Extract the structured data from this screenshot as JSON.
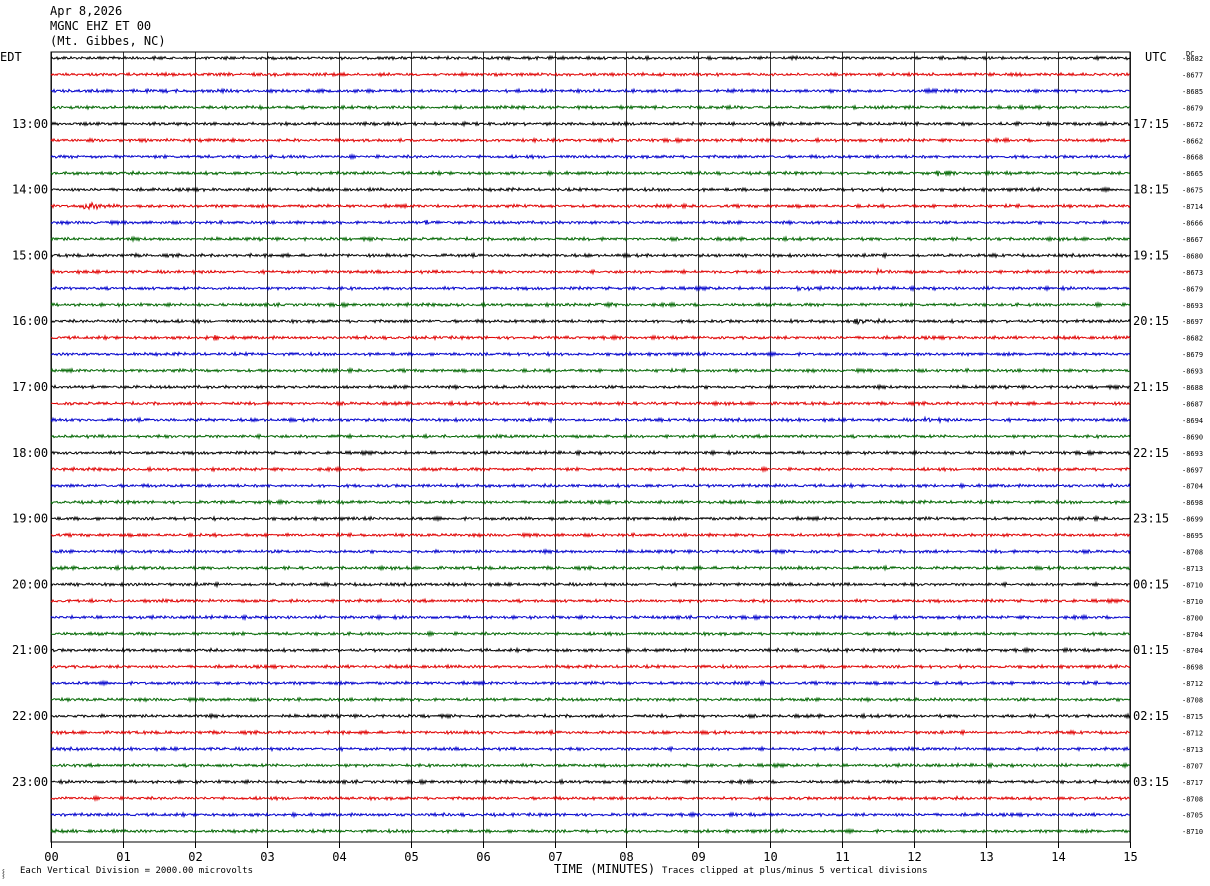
{
  "header": {
    "date": "Apr 8,2026",
    "station": "MGNC EHZ ET 00",
    "location": "(Mt. Gibbes, NC)"
  },
  "footer": {
    "scale_note": "Each Vertical Division = 2000.00 microvolts",
    "clip_note": "Traces clipped at plus/minus 5 vertical divisions",
    "corner_mark": "⸾"
  },
  "chart_data": {
    "type": "line",
    "title": "",
    "xlabel": "TIME (MINUTES)",
    "ylabel_left": "EDT",
    "ylabel_right": "UTC",
    "dc_label": "DC",
    "xlim": [
      0,
      15
    ],
    "x_ticks": [
      "00",
      "01",
      "02",
      "03",
      "04",
      "05",
      "06",
      "07",
      "08",
      "09",
      "10",
      "11",
      "12",
      "13",
      "14",
      "15"
    ],
    "trace_colors": [
      "#000000",
      "#e00000",
      "#0000cc",
      "#006600"
    ],
    "left_hour_labels": [
      "13:00",
      "14:00",
      "15:00",
      "16:00",
      "17:00",
      "18:00",
      "19:00",
      "20:00",
      "21:00",
      "22:00",
      "23:00"
    ],
    "right_hour_labels": [
      "17:15",
      "18:15",
      "19:15",
      "20:15",
      "21:15",
      "22:15",
      "23:15",
      "00:15",
      "01:15",
      "02:15",
      "03:15"
    ],
    "dc_offsets": [
      -8682,
      -8677,
      -8685,
      -8679,
      -8672,
      -8662,
      -8668,
      -8665,
      -8675,
      -8714,
      -8666,
      -8667,
      -8680,
      -8673,
      -8679,
      -8693,
      -8697,
      -8682,
      -8679,
      -8693,
      -8688,
      -8687,
      -8694,
      -8690,
      -8693,
      -8697,
      -8704,
      -8698,
      -8699,
      -8695,
      -8708,
      -8713,
      -8710,
      -8710,
      -8700,
      -8704,
      -8704,
      -8698,
      -8712,
      -8708,
      -8715,
      -8712,
      -8713,
      -8707,
      -8717,
      -8708,
      -8705,
      -8710
    ],
    "events": [
      {
        "trace": 0,
        "minute": 5.85,
        "amplitude": 1.6
      },
      {
        "trace": 7,
        "minute": 12.35,
        "amplitude": 1.5
      },
      {
        "trace": 9,
        "minute": 0.5,
        "amplitude": 5.0
      },
      {
        "trace": 10,
        "minute": 5.2,
        "amplitude": 1.6
      },
      {
        "trace": 13,
        "minute": 11.5,
        "amplitude": 1.6
      },
      {
        "trace": 14,
        "minute": 10.4,
        "amplitude": 1.6
      },
      {
        "trace": 15,
        "minute": 7.65,
        "amplitude": 1.6
      },
      {
        "trace": 16,
        "minute": 0.9,
        "amplitude": 1.7
      },
      {
        "trace": 16,
        "minute": 1.4,
        "amplitude": 1.7
      },
      {
        "trace": 16,
        "minute": 11.2,
        "amplitude": 3.0
      },
      {
        "trace": 17,
        "minute": 2.2,
        "amplitude": 1.6
      },
      {
        "trace": 22,
        "minute": 12.2,
        "amplitude": 2.2
      }
    ]
  }
}
